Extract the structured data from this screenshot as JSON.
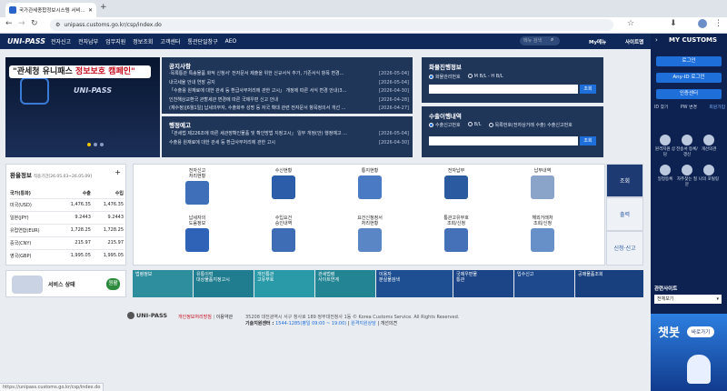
{
  "browser": {
    "tab_title": "국가관세종합정보시스템 서비...",
    "url": "unipass.customs.go.kr/csp/index.do"
  },
  "header": {
    "logo": "UNI-PASS",
    "menus": [
      "전자신고",
      "전자납부",
      "업무지원",
      "정보조회",
      "고객센터",
      "통관단일창구",
      "AEO"
    ],
    "search_placeholder": "메뉴 검색",
    "my_menu": "My메뉴",
    "sitemap": "사이트맵"
  },
  "right": {
    "title": "MY CUSTOMS",
    "login": "로그인",
    "any_id": "Any-ID 로그인",
    "cert": "인증센터",
    "links": [
      "ID 찾기",
      "PW 변경",
      "회원가입"
    ],
    "quick": [
      "원격지원 상담",
      "전송서 등록/갱신",
      "개선의견",
      "일정등록",
      "자주찾는 질문",
      "나의 포털링"
    ],
    "related_title": "관련사이트",
    "related_select": "전체보기",
    "chatbot": "챗봇",
    "chatbot_btn": "바로가기"
  },
  "banner": {
    "brand": "UNI-PASS",
    "line1": "\"관세청 유니패스 ",
    "line2": "정보보호 캠페인\""
  },
  "notice": {
    "title": "공지사항",
    "items": [
      {
        "t": "·목록통관 특송물품 화적 신청서' 전자문서 제출을 위한 신규서식 추가, 기존서식 항목 변경...",
        "d": "[2026-05-04]"
      },
      {
        "t": "내국세율 안내 연장 공지",
        "d": "[2026-05-04]"
      },
      {
        "t": "「수출용 원재료에 대한 관세 등 환급사무처리에 관한 고시」 개정에 따른 서식 변경 안내(3...",
        "d": "[2026-04-30]"
      },
      {
        "t": "인천해상교환국 관할세관 변경에 따른 국제우편 신고 안내",
        "d": "[2026-04-28]"
      },
      {
        "t": "(재수정)[6월1일] 납세의무자, 수출화주 성명 등 자국 확대 관련 전자문서 항목정의서 개선 ...",
        "d": "[2026-04-27]"
      }
    ]
  },
  "admin": {
    "title": "행정예고",
    "items": [
      {
        "t": "「관세법 제226조에 따른 세관장확인물품 및 확인방법 지정고시」 일부 개정(안) 행정예고 ...",
        "d": "[2026-05-04]"
      },
      {
        "t": "수출용 원재료에 대한 관세 등 환급사무처리에 관한 고시",
        "d": "[2026-04-30]"
      }
    ]
  },
  "cargo": {
    "title": "화물진행정보",
    "r1": "화물관리번호",
    "r2": "M B/L - H B/L",
    "btn": "조회"
  },
  "export": {
    "title": "수출이행내역",
    "r1": "수출신고번호",
    "r2": "B/L",
    "r3": "목록번호(전자상거래 수출) 수출신고번호",
    "btn": "조회"
  },
  "exchange": {
    "title": "환율정보",
    "period": "적용기간[26.05.03~26.05.09]",
    "plus": "+",
    "headers": [
      "국가(통화)",
      "수출",
      "수입"
    ],
    "rows": [
      {
        "c": "미국(USD)",
        "e": "1,476.35",
        "i": "1,476.35"
      },
      {
        "c": "일본(JPY)",
        "e": "9.2443",
        "i": "9.2443"
      },
      {
        "c": "유럽연합(EUR)",
        "e": "1,728.25",
        "i": "1,728.25"
      },
      {
        "c": "중국(CNY)",
        "e": "215.97",
        "i": "215.97"
      },
      {
        "c": "영국(GBP)",
        "e": "1,995.05",
        "i": "1,995.05"
      }
    ]
  },
  "grid": {
    "row1": [
      "전자신고\n처리현황",
      "수신현황",
      "통지현황",
      "전자납부",
      "납부내역"
    ],
    "row2": [
      "납세자의\n도움정보",
      "수입요건\n승인내역",
      "요건신청정서\n처리현황",
      "통관고유부호\n조회/신청",
      "해외거래처\n조회/신청"
    ]
  },
  "side_tabs": [
    "조회",
    "출력",
    "신청·신고"
  ],
  "service": {
    "label": "서비스 상태",
    "status": "원활"
  },
  "tiles": [
    "법령정보",
    "유통이력\n대상물품지정고시",
    "개인통관\n고유부호",
    "관세법령\n사이트연계",
    "이용자\n분실물검색",
    "국제우편물\n통관",
    "입수신고",
    "공매물품조회"
  ],
  "footer": {
    "logo": "UNI-PASS",
    "privacy": "개인정보처리방침",
    "terms": "이용약관",
    "address": "35208 대전광역시 서구 청사로 189 정부대전청사 1동 © Korea Customs Service. All Rights Reserved.",
    "help_label": "기술지원센터 : ",
    "help_phone": "1544-1285(평일 09:00 ~ 19:00)",
    "remote": "원격지원상담",
    "improve": "개선의견"
  },
  "status_url": "https://unipass.customs.go.kr/csp/index.do"
}
